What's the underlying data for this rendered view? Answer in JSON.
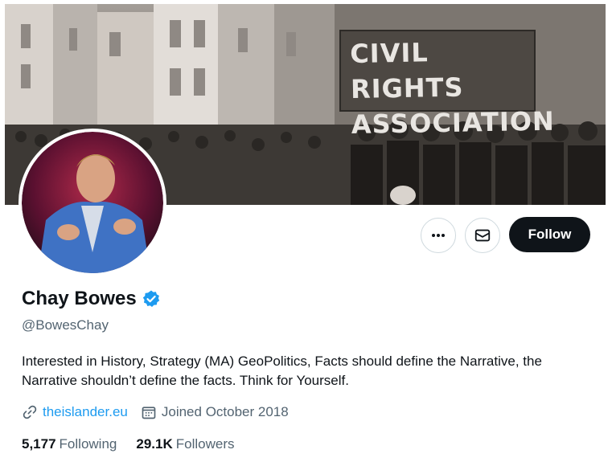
{
  "banner": {
    "sign_lines": [
      "CIVIL RIGHTS",
      "ASSOCIATION"
    ]
  },
  "actions": {
    "more_icon": "more-horizontal-icon",
    "message_icon": "mail-icon",
    "follow_label": "Follow"
  },
  "profile": {
    "name": "Chay Bowes",
    "handle": "@BowesChay",
    "verified": true,
    "bio": "Interested in History, Strategy (MA) GeoPolitics, Facts should define the Narrative, the Narrative shouldn’t define the facts. Think for Yourself.",
    "website": "theislander.eu",
    "joined": "Joined October 2018"
  },
  "stats": {
    "following_count": "5,177",
    "following_label": "Following",
    "followers_count": "29.1K",
    "followers_label": "Followers"
  },
  "colors": {
    "accent": "#1d9bf0",
    "follow_bg": "#0f1419",
    "muted_text": "#536471"
  }
}
